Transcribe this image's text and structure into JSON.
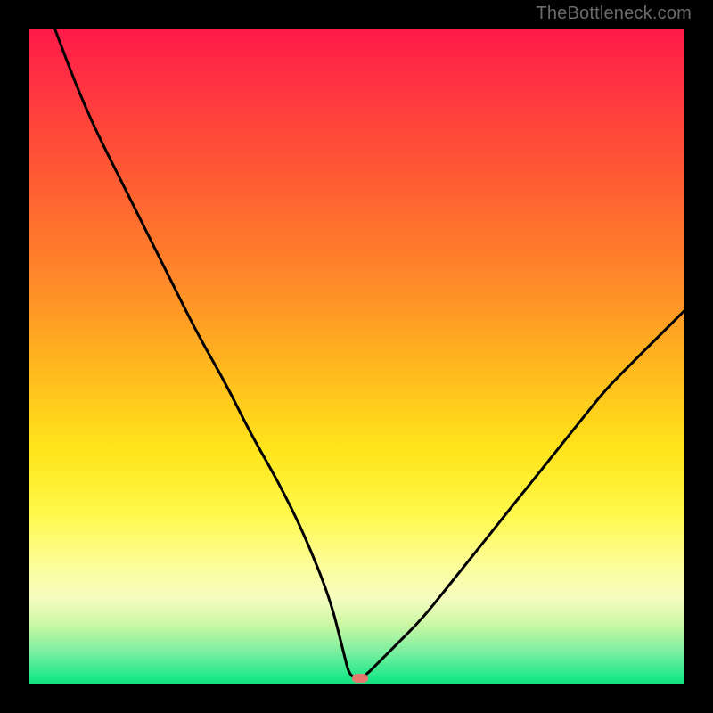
{
  "watermark": "TheBottleneck.com",
  "marker": {
    "x_pct": 50.5,
    "y_pct": 99
  },
  "chart_data": {
    "type": "line",
    "title": "",
    "xlabel": "",
    "ylabel": "",
    "xlim": [
      0,
      100
    ],
    "ylim": [
      0,
      100
    ],
    "grid": false,
    "legend": false,
    "curve_description": "V-shaped bottleneck curve; minimum near x≈49–51%, rising steeply to both sides. Left branch reaches top (y≈100) near x≈4; right branch reaches y≈57 at x=100.",
    "series": [
      {
        "name": "bottleneck-curve",
        "x": [
          4,
          7,
          10,
          14,
          18,
          22,
          26,
          30,
          34,
          38,
          42,
          46,
          48,
          49,
          51,
          53,
          56,
          60,
          64,
          68,
          72,
          76,
          80,
          84,
          88,
          92,
          96,
          100
        ],
        "y": [
          100,
          92,
          85,
          77,
          69,
          61,
          53,
          46,
          38,
          31,
          23,
          13,
          5,
          1,
          1,
          3,
          6,
          10,
          15,
          20,
          25,
          30,
          35,
          40,
          45,
          49,
          53,
          57
        ]
      }
    ],
    "gradient_stops": [
      {
        "pos": 0.0,
        "color": "#ff1a4a"
      },
      {
        "pos": 0.12,
        "color": "#ff3d3d"
      },
      {
        "pos": 0.28,
        "color": "#ff6a2f"
      },
      {
        "pos": 0.4,
        "color": "#ff8e28"
      },
      {
        "pos": 0.52,
        "color": "#ffb91e"
      },
      {
        "pos": 0.64,
        "color": "#ffe41a"
      },
      {
        "pos": 0.74,
        "color": "#fff94a"
      },
      {
        "pos": 0.82,
        "color": "#fdfd9c"
      },
      {
        "pos": 0.87,
        "color": "#f4fdc0"
      },
      {
        "pos": 0.91,
        "color": "#c9f7a3"
      },
      {
        "pos": 0.95,
        "color": "#7aefa0"
      },
      {
        "pos": 0.99,
        "color": "#1ee889"
      },
      {
        "pos": 1.0,
        "color": "#12e07e"
      }
    ],
    "marker": {
      "x": 50.5,
      "y": 1,
      "color": "#e77a6f"
    }
  }
}
